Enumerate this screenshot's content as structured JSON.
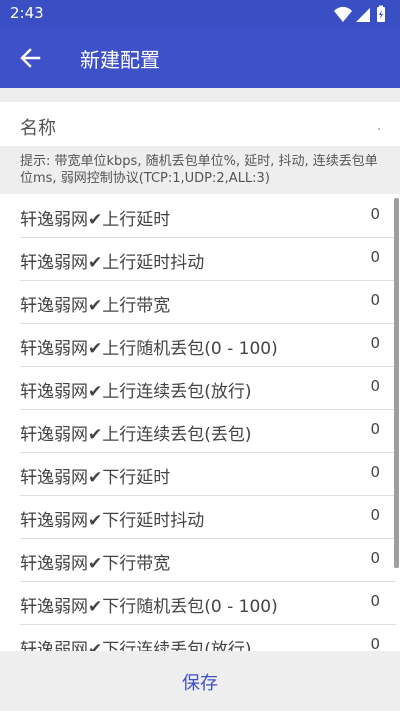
{
  "status_bar": {
    "time": "2:43",
    "icons": [
      "wifi-icon",
      "signal-icon",
      "battery-icon"
    ]
  },
  "app_bar": {
    "title": "新建配置",
    "back_icon": "arrow-back-icon"
  },
  "name_field": {
    "label": "名称",
    "value": ""
  },
  "hint": "提示: 带宽单位kbps, 随机丢包单位%, 延时, 抖动, 连续丢包单位ms, 弱网控制协议(TCP:1,UDP:2,ALL:3)",
  "items": [
    {
      "label": "轩逸弱网✔上行延时",
      "value": "0"
    },
    {
      "label": "轩逸弱网✔上行延时抖动",
      "value": "0"
    },
    {
      "label": "轩逸弱网✔上行带宽",
      "value": "0"
    },
    {
      "label": "轩逸弱网✔上行随机丢包(0 - 100)",
      "value": "0"
    },
    {
      "label": "轩逸弱网✔上行连续丢包(放行)",
      "value": "0"
    },
    {
      "label": "轩逸弱网✔上行连续丢包(丢包)",
      "value": "0"
    },
    {
      "label": "轩逸弱网✔下行延时",
      "value": "0"
    },
    {
      "label": "轩逸弱网✔下行延时抖动",
      "value": "0"
    },
    {
      "label": "轩逸弱网✔下行带宽",
      "value": "0"
    },
    {
      "label": "轩逸弱网✔下行随机丢包(0 - 100)",
      "value": "0"
    },
    {
      "label": "轩逸弱网✔下行连续丢包(放行)",
      "value": "0"
    }
  ],
  "save_label": "保存",
  "colors": {
    "primary": "#3f51c8",
    "status": "#3b4fc4",
    "background_gray": "#eeeeee"
  }
}
